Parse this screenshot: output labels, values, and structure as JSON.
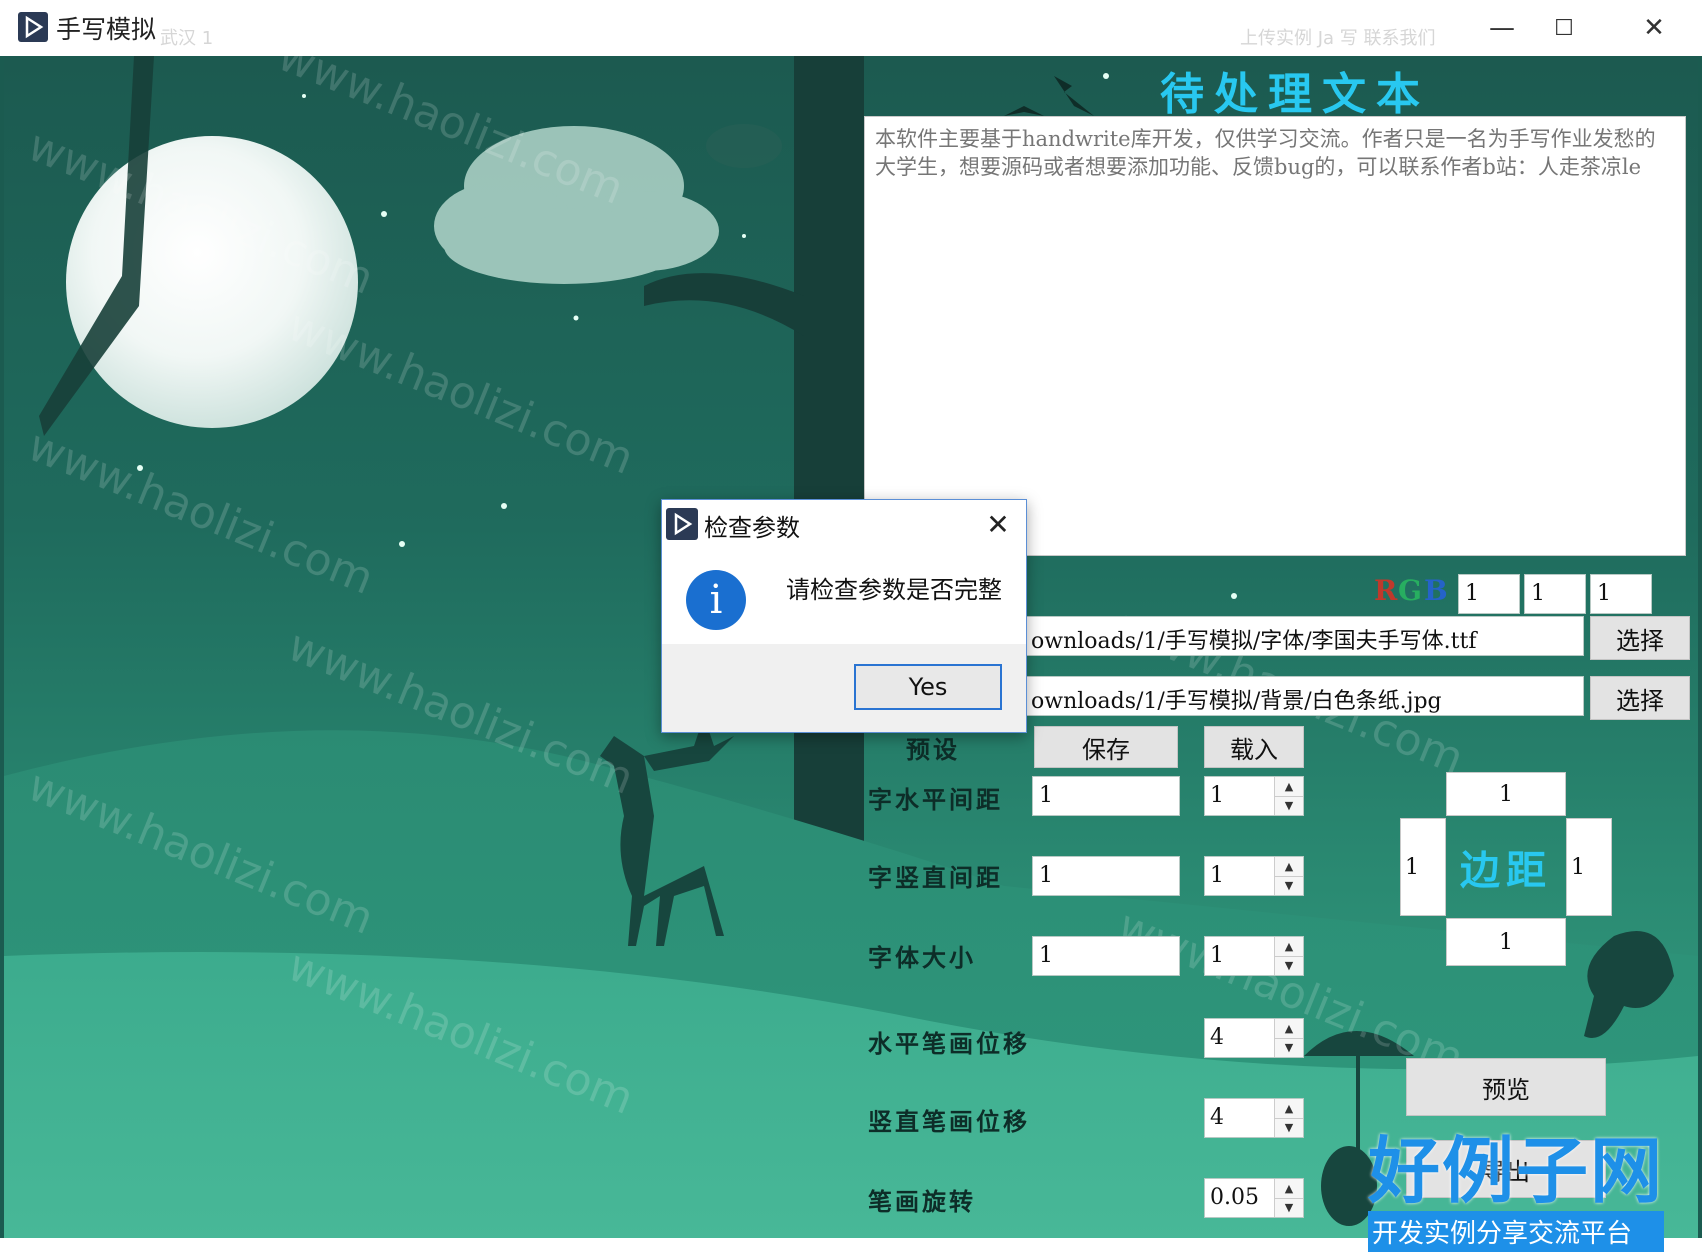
{
  "window": {
    "title": "手写模拟",
    "minimize": "—",
    "maximize": "☐",
    "close": "✕"
  },
  "background_ghost": {
    "left_text": "武汉 1",
    "right_text": "上传实例    Ja    写    联系我们"
  },
  "text_panel": {
    "heading": "待处理文本",
    "content": "本软件主要基于handwrite库开发，仅供学习交流。作者只是一名为手写作业发愁的大学生，想要源码或者想要添加功能、反馈bug的，可以联系作者b站：人走茶凉le"
  },
  "color": {
    "r_label": "R",
    "g_label": "G",
    "b_label": "B",
    "r": "1",
    "g": "1",
    "b": "1"
  },
  "font_path": {
    "value": "ownloads/1/手写模拟/字体/李国夫手写体.ttf",
    "button": "选择"
  },
  "bg_path": {
    "value": "ownloads/1/手写模拟/背景/白色条纸.jpg",
    "button": "选择"
  },
  "preset": {
    "label": "预设",
    "save": "保存",
    "load": "载入"
  },
  "params": {
    "h_spacing": {
      "label": "字水平间距",
      "text": "1",
      "spin": "1"
    },
    "v_spacing": {
      "label": "字竖直间距",
      "text": "1",
      "spin": "1"
    },
    "font_size": {
      "label": "字体大小",
      "text": "1",
      "spin": "1"
    },
    "h_offset": {
      "label": "水平笔画位移",
      "spin": "4"
    },
    "v_offset": {
      "label": "竖直笔画位移",
      "spin": "4"
    },
    "rotation": {
      "label": "笔画旋转",
      "spin": "0.05"
    }
  },
  "margins": {
    "label": "边距",
    "top": "1",
    "left": "1",
    "right": "1",
    "bottom": "1"
  },
  "actions": {
    "preview": "预览",
    "export": "导出"
  },
  "watermark": {
    "site": "www.haolizi.com",
    "brand_big": "好例子网",
    "brand_small": "开发实例分享交流平台"
  },
  "dialog": {
    "title": "检查参数",
    "message": "请检查参数是否完整",
    "info_icon": "i",
    "close": "✕",
    "yes": "Yes"
  },
  "colors": {
    "heading": "#28c8f0",
    "r": "#c0392b",
    "g": "#27ae60",
    "b": "#2563c9",
    "scene_dark": "#1c5a50",
    "scene_light": "#3aa386"
  }
}
